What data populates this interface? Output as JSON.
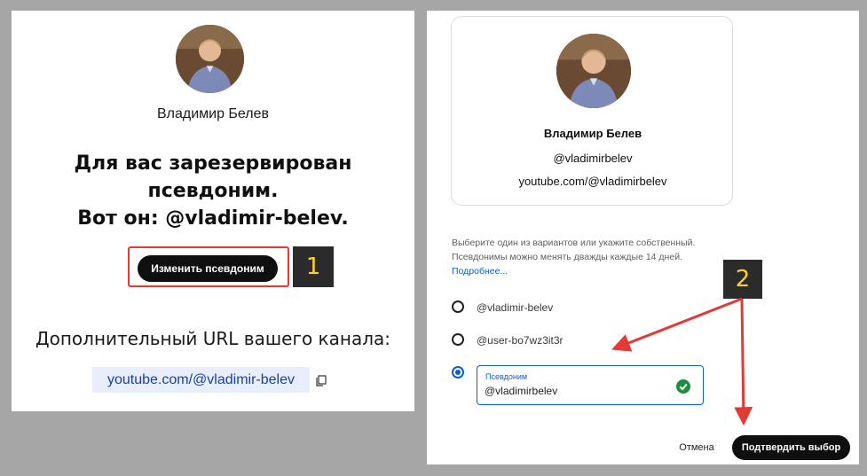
{
  "left_panel": {
    "user_name": "Владимир Белев",
    "reserved_line1": "Для вас зарезервирован",
    "reserved_line2": "псевдоним.",
    "reserved_line3": "Вот он: @vladimir-belev.",
    "change_button": "Изменить псевдоним",
    "extra_url_label": "Дополнительный URL вашего канала:",
    "channel_url": "youtube.com/@vladimir-belev"
  },
  "markers": {
    "one": "1",
    "two": "2"
  },
  "right_panel": {
    "card": {
      "name": "Владимир Белев",
      "handle": "@vladimirbelev",
      "url": "youtube.com/@vladimirbelev"
    },
    "help_line1": "Выберите один из вариантов или укажите собственный.",
    "help_line2": "Псевдонимы можно менять дважды каждые 14 дней.",
    "more_link": "Подробнее...",
    "options": [
      {
        "label": "@vladimir-belev",
        "selected": false
      },
      {
        "label": "@user-bo7wz3it3r",
        "selected": false
      }
    ],
    "custom_field": {
      "label": "Псевдоним",
      "value": "@vladimirbelev",
      "selected": true
    },
    "cancel_button": "Отмена",
    "confirm_button": "Подтвердить выбор"
  },
  "colors": {
    "background": "#a6a6a6",
    "accent_blue": "#065fd4",
    "annotation_red": "#e53935",
    "marker_yellow": "#ffd21f",
    "success_green": "#1e8e3e"
  },
  "icons": {
    "copy": "copy-icon",
    "check": "check-circle-icon"
  }
}
